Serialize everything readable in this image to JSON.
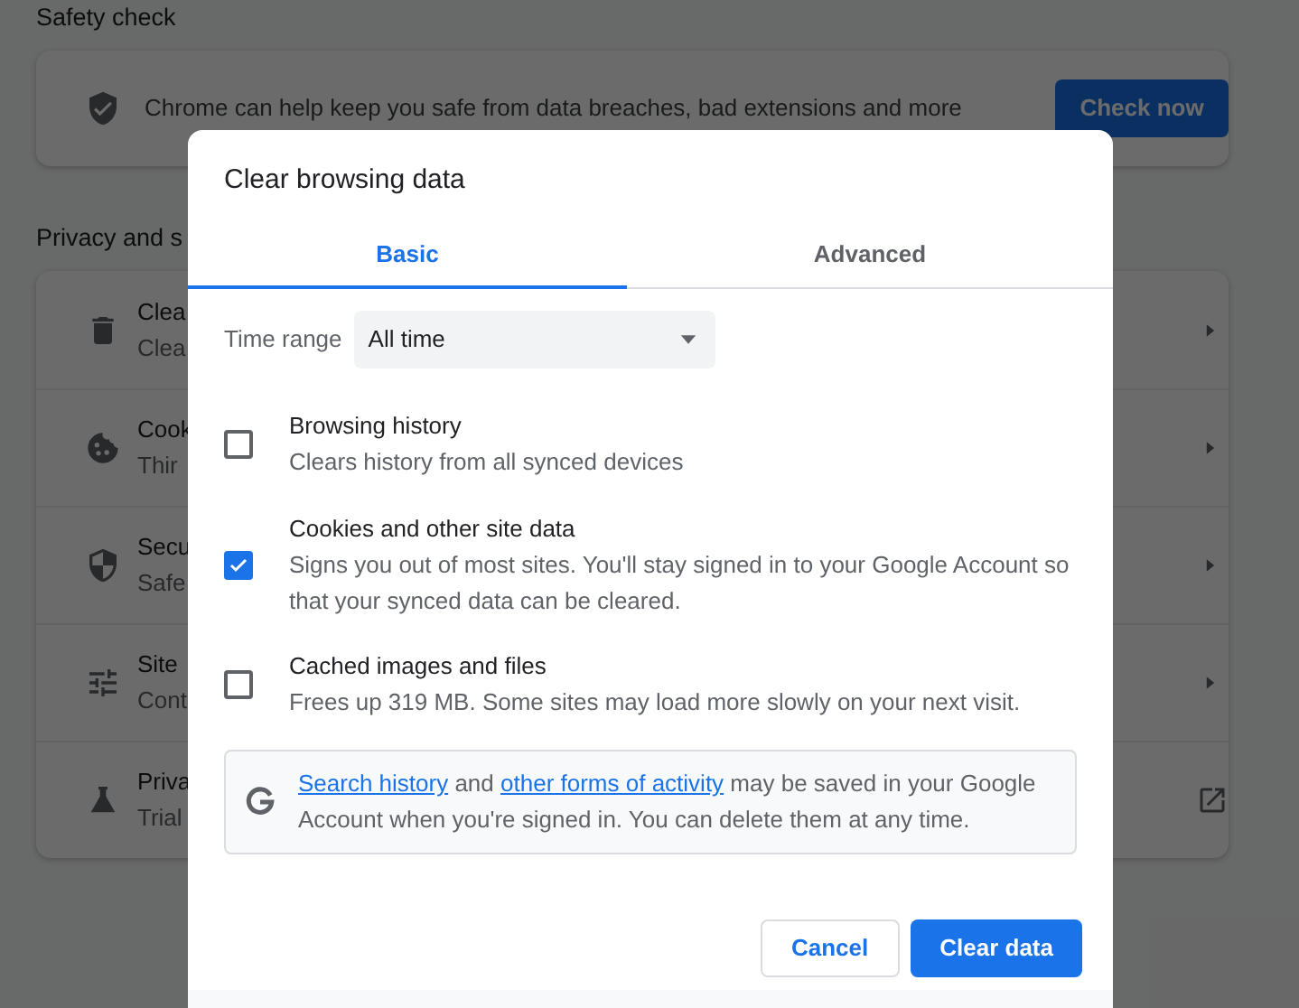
{
  "settings": {
    "safety_check": {
      "heading": "Safety check",
      "text": "Chrome can help keep you safe from data breaches, bad extensions and more",
      "button": "Check now"
    },
    "privacy": {
      "heading": "Privacy and s",
      "rows": [
        {
          "kind": "arrow",
          "title": "Clea",
          "subtitle": "Clea"
        },
        {
          "kind": "arrow",
          "title": "Cook",
          "subtitle": "Thir"
        },
        {
          "kind": "arrow",
          "title": "Secu",
          "subtitle": "Safe"
        },
        {
          "kind": "arrow",
          "title": "Site",
          "subtitle": "Cont"
        },
        {
          "kind": "external",
          "title": "Priva",
          "subtitle": "Trial"
        }
      ]
    }
  },
  "dialog": {
    "title": "Clear browsing data",
    "tabs": [
      {
        "label": "Basic",
        "selected": true
      },
      {
        "label": "Advanced",
        "selected": false
      }
    ],
    "time_range": {
      "label": "Time range",
      "value": "All time"
    },
    "options": [
      {
        "title": "Browsing history",
        "description": "Clears history from all synced devices",
        "checked": false
      },
      {
        "title": "Cookies and other site data",
        "description": "Signs you out of most sites. You'll stay signed in to your Google Account so that your synced data can be cleared.",
        "checked": true
      },
      {
        "title": "Cached images and files",
        "description": "Frees up 319 MB. Some sites may load more slowly on your next visit.",
        "checked": false
      }
    ],
    "notice": [
      {
        "kind": "link",
        "text": "Search history"
      },
      {
        "kind": "text",
        "text": " and "
      },
      {
        "kind": "link",
        "text": "other forms of activity"
      },
      {
        "kind": "text",
        "text": " may be saved in your Google Account when you're signed in. You can delete them at any time."
      }
    ],
    "buttons": [
      {
        "kind": "secondary",
        "label": "Cancel"
      },
      {
        "kind": "primary",
        "label": "Clear data"
      }
    ]
  }
}
